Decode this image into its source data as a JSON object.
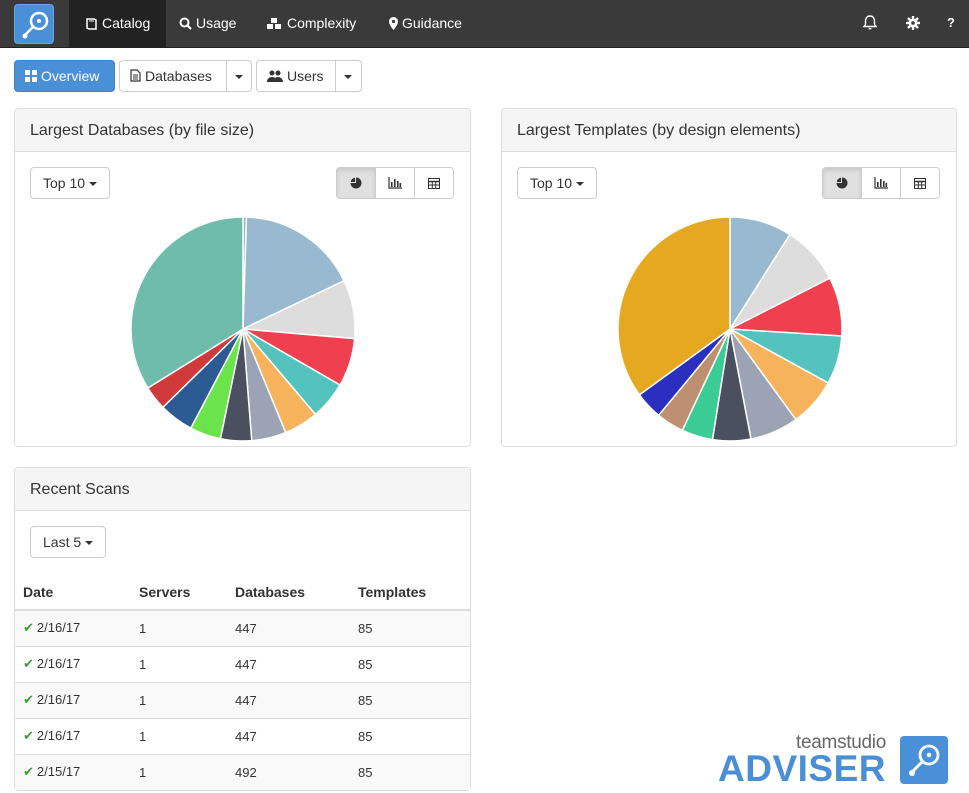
{
  "nav": {
    "items": [
      {
        "label": "Catalog",
        "active": true
      },
      {
        "label": "Usage"
      },
      {
        "label": "Complexity"
      },
      {
        "label": "Guidance"
      }
    ],
    "help": "?"
  },
  "toolbar": {
    "overview": "Overview",
    "databases": "Databases",
    "users": "Users"
  },
  "panels": {
    "databases": {
      "title": "Largest Databases (by file size)",
      "filter": "Top 10",
      "chart_type": "pie"
    },
    "templates": {
      "title": "Largest Templates (by design elements)",
      "filter": "Top 10",
      "chart_type": "pie"
    },
    "scans": {
      "title": "Recent Scans",
      "filter": "Last 5",
      "columns": [
        "Date",
        "Servers",
        "Databases",
        "Templates"
      ],
      "rows": [
        {
          "date": "2/16/17",
          "servers": "1",
          "databases": "447",
          "templates": "85"
        },
        {
          "date": "2/16/17",
          "servers": "1",
          "databases": "447",
          "templates": "85"
        },
        {
          "date": "2/16/17",
          "servers": "1",
          "databases": "447",
          "templates": "85"
        },
        {
          "date": "2/16/17",
          "servers": "1",
          "databases": "447",
          "templates": "85"
        },
        {
          "date": "2/15/17",
          "servers": "1",
          "databases": "492",
          "templates": "85"
        }
      ]
    }
  },
  "brand": {
    "small": "teamstudio",
    "big": "ADVISER"
  },
  "chart_data": [
    {
      "type": "pie",
      "title": "Largest Databases (by file size)",
      "values": [
        0.5,
        17.5,
        8.5,
        7,
        5.5,
        5,
        5,
        4.5,
        4.5,
        5,
        3.5,
        34
      ],
      "colors": [
        "#98b9cf",
        "#98b9cf",
        "#dddddd",
        "#f04050",
        "#54c3bd",
        "#f7b35b",
        "#9ba3b4",
        "#4b5060",
        "#6be44b",
        "#2c5a92",
        "#d13a3a",
        "#6fbcaa"
      ]
    },
    {
      "type": "pie",
      "title": "Largest Templates (by design elements)",
      "values": [
        9,
        8.5,
        8.5,
        7,
        7,
        7,
        5.5,
        4.5,
        4,
        4,
        35
      ],
      "colors": [
        "#98b9cf",
        "#dddddd",
        "#f04050",
        "#54c3bd",
        "#f7b35b",
        "#9ba3b4",
        "#4b5060",
        "#3acc94",
        "#bd9071",
        "#2a2fbf",
        "#e7a821"
      ]
    }
  ]
}
